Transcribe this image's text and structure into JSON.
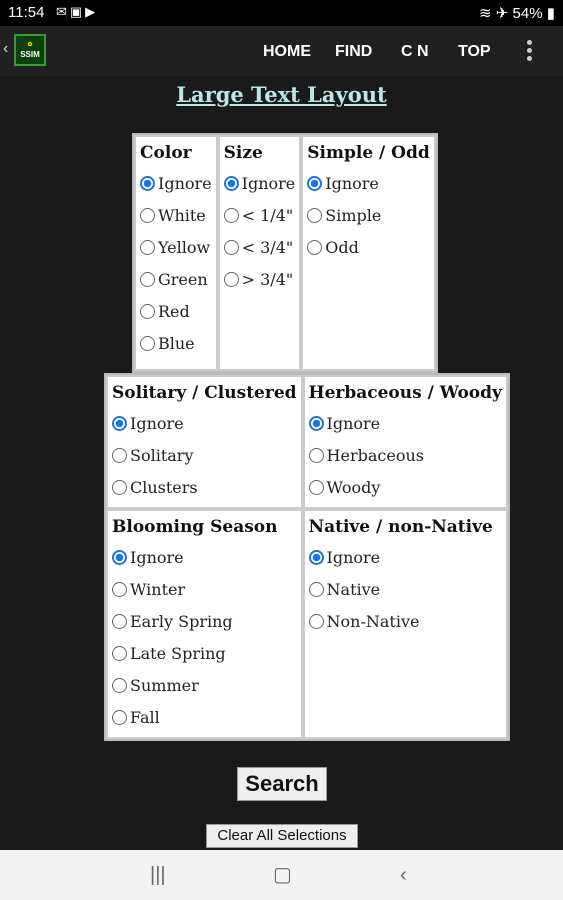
{
  "status": {
    "time": "11:54",
    "battery": "54%"
  },
  "header": {
    "nav": [
      "HOME",
      "FIND",
      "C N",
      "TOP"
    ],
    "logo_text": "SSIM"
  },
  "title": "Large Text Layout",
  "groups": {
    "color": {
      "title": "Color",
      "options": [
        "Ignore",
        "White",
        "Yellow",
        "Green",
        "Red",
        "Blue"
      ],
      "selected": "Ignore"
    },
    "size": {
      "title": "Size",
      "options": [
        "Ignore",
        "< 1/4\"",
        "< 3/4\"",
        "> 3/4\""
      ],
      "selected": "Ignore"
    },
    "simple_odd": {
      "title": "Simple / Odd",
      "options": [
        "Ignore",
        "Simple",
        "Odd"
      ],
      "selected": "Ignore"
    },
    "solitary_clustered": {
      "title": "Solitary / Clustered",
      "options": [
        "Ignore",
        "Solitary",
        "Clusters"
      ],
      "selected": "Ignore"
    },
    "herbaceous_woody": {
      "title": "Herbaceous / Woody",
      "options": [
        "Ignore",
        "Herbaceous",
        "Woody"
      ],
      "selected": "Ignore"
    },
    "blooming_season": {
      "title": "Blooming Season",
      "options": [
        "Ignore",
        "Winter",
        "Early Spring",
        "Late Spring",
        "Summer",
        "Fall"
      ],
      "selected": "Ignore"
    },
    "native": {
      "title": "Native / non-Native",
      "options": [
        "Ignore",
        "Native",
        "Non-Native"
      ],
      "selected": "Ignore"
    }
  },
  "buttons": {
    "search": "Search",
    "clear": "Clear All Selections"
  }
}
